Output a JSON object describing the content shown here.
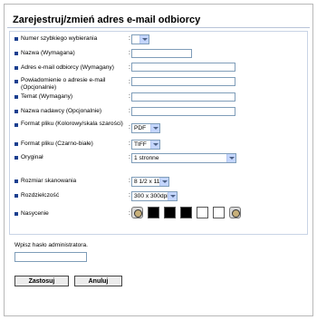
{
  "title": "Zarejestruj/zmień adres e-mail odbiorcy",
  "fields": {
    "speed_dial": {
      "label": "Numer szybkiego wybierania",
      "value": ""
    },
    "name": {
      "label": "Nazwa (Wymagana)",
      "value": ""
    },
    "email": {
      "label": "Adres e-mail odbiorcy (Wymagany)",
      "value": ""
    },
    "notify": {
      "label": "Powiadomienie o adresie e-mail (Opcjonalnie)",
      "value": ""
    },
    "subject": {
      "label": "Temat (Wymagany)",
      "value": ""
    },
    "sender": {
      "label": "Nazwa nadawcy (Opcjonalnie)",
      "value": ""
    },
    "format_color": {
      "label": "Format pliku (Kolorowy/skala szarości)",
      "value": "PDF"
    },
    "format_bw": {
      "label": "Format pliku (Czarno-białe)",
      "value": "TIFF"
    },
    "original": {
      "label": "Oryginał",
      "value": "1 stronne"
    },
    "scan_size": {
      "label": "Rozmiar skanowania",
      "value": "8 1/2 x 11"
    },
    "resolution": {
      "label": "Rozdzielczość",
      "value": "300 x 300dpi"
    },
    "saturation": {
      "label": "Nasycenie"
    }
  },
  "colon": ":",
  "admin": {
    "label": "Wpisz hasło administratora.",
    "value": ""
  },
  "buttons": {
    "apply": "Zastosuj",
    "cancel": "Anuluj"
  },
  "colors": {
    "bullet": "#1b3f8f",
    "input_border": "#7f9db9",
    "dropdown_arrow_bg": "#c3d5fd",
    "panel_border": "#c9d4e6"
  },
  "icons": {
    "bullet": "square-bullet-icon",
    "dropdown": "chevron-down-icon",
    "saturation_decrease": "saturation-decrease-icon",
    "saturation_increase": "saturation-increase-icon"
  }
}
